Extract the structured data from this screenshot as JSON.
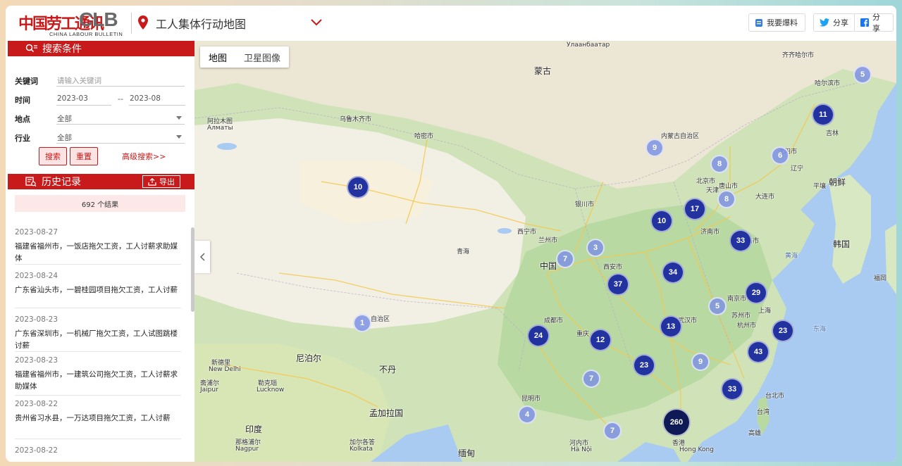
{
  "header": {
    "logo_cn": "中国劳工通讯",
    "logo_en": "CLB",
    "logo_sub": "CHINA LABOUR BULLETIN",
    "title": "工人集体行动地图",
    "report_label": "我要爆料",
    "share_twitter": "分享",
    "share_facebook": "分享"
  },
  "search": {
    "heading": "搜索条件",
    "keyword_label": "关键词",
    "keyword_placeholder": "请输入关键词",
    "time_label": "时间",
    "date_from": "2023-03",
    "date_sep": "--",
    "date_to": "2023-08",
    "location_label": "地点",
    "location_value": "全部",
    "industry_label": "行业",
    "industry_value": "全部",
    "search_button": "搜索",
    "reset_button": "重置",
    "advanced_link": "高级搜索>>"
  },
  "history": {
    "heading": "历史记录",
    "export_label": "导出",
    "results_count": "692 个结果",
    "items": [
      {
        "date": "2023-08-27",
        "text": "福建省福州市，一饭店拖欠工资，工人讨薪求助媒体"
      },
      {
        "date": "2023-08-24",
        "text": "广东省汕头市，一碧桂园项目拖欠工资，工人讨薪"
      },
      {
        "date": "2023-08-23",
        "text": "广东省深圳市，一机械厂拖欠工资，工人试图跳楼讨薪"
      },
      {
        "date": "2023-08-23",
        "text": "福建省福州市，一建筑公司拖欠工资，工人讨薪求助媒体"
      },
      {
        "date": "2023-08-22",
        "text": "贵州省习水县，一万达项目拖欠工资，工人讨薪"
      },
      {
        "date": "2023-08-22",
        "text": ""
      }
    ]
  },
  "map": {
    "map_tab": "地图",
    "satellite_tab": "卫星图像",
    "labels": [
      {
        "text": "Улаанбаатар",
        "cls": ""
      },
      {
        "text": "蒙古",
        "cls": "big"
      },
      {
        "text": "齐齐哈尔市",
        "cls": ""
      },
      {
        "text": "哈尔滨市",
        "cls": ""
      },
      {
        "text": "吉林",
        "cls": ""
      },
      {
        "text": "沈阳市",
        "cls": ""
      },
      {
        "text": "辽宁",
        "cls": ""
      },
      {
        "text": "朝鲜",
        "cls": "big"
      },
      {
        "text": "平壤",
        "cls": ""
      },
      {
        "text": "大连市",
        "cls": ""
      },
      {
        "text": "韩国",
        "cls": "big"
      },
      {
        "text": "黄海",
        "cls": "sea"
      },
      {
        "text": "东海",
        "cls": "sea"
      },
      {
        "text": "北京市",
        "cls": ""
      },
      {
        "text": "天津",
        "cls": ""
      },
      {
        "text": "唐山市",
        "cls": ""
      },
      {
        "text": "济南市",
        "cls": ""
      },
      {
        "text": "青岛市",
        "cls": ""
      },
      {
        "text": "内蒙古自治区",
        "cls": ""
      },
      {
        "text": "银川市",
        "cls": ""
      },
      {
        "text": "兰州市",
        "cls": ""
      },
      {
        "text": "西宁市",
        "cls": ""
      },
      {
        "text": "中国",
        "cls": "big"
      },
      {
        "text": "西安市",
        "cls": ""
      },
      {
        "text": "南京市",
        "cls": ""
      },
      {
        "text": "上海",
        "cls": ""
      },
      {
        "text": "苏州市",
        "cls": ""
      },
      {
        "text": "杭州市",
        "cls": ""
      },
      {
        "text": "武汉市",
        "cls": ""
      },
      {
        "text": "成都市",
        "cls": ""
      },
      {
        "text": "重庆",
        "cls": ""
      },
      {
        "text": "昆明市",
        "cls": ""
      },
      {
        "text": "台北市",
        "cls": ""
      },
      {
        "text": "台湾",
        "cls": ""
      },
      {
        "text": "高雄",
        "cls": ""
      },
      {
        "text": "香港",
        "cls": ""
      },
      {
        "text": "Hong Kong",
        "cls": ""
      },
      {
        "text": "河内市",
        "cls": ""
      },
      {
        "text": "Hà Nội",
        "cls": ""
      },
      {
        "text": "缅甸",
        "cls": "big"
      },
      {
        "text": "不丹",
        "cls": "big"
      },
      {
        "text": "尼泊尔",
        "cls": "big"
      },
      {
        "text": "孟加拉国",
        "cls": "big"
      },
      {
        "text": "印度",
        "cls": "big"
      },
      {
        "text": "新德里",
        "cls": ""
      },
      {
        "text": "New Delhi",
        "cls": ""
      },
      {
        "text": "斋浦尔",
        "cls": ""
      },
      {
        "text": "Jaipur",
        "cls": ""
      },
      {
        "text": "勒克瑙",
        "cls": ""
      },
      {
        "text": "Lucknow",
        "cls": ""
      },
      {
        "text": "加尔各答",
        "cls": ""
      },
      {
        "text": "Kolkata",
        "cls": ""
      },
      {
        "text": "那格浦尔",
        "cls": ""
      },
      {
        "text": "Nagpur",
        "cls": ""
      },
      {
        "text": "阿拉木图",
        "cls": ""
      },
      {
        "text": "Алматы",
        "cls": ""
      },
      {
        "text": "乌鲁木齐市",
        "cls": ""
      },
      {
        "text": "哈密市",
        "cls": ""
      },
      {
        "text": "青海",
        "cls": ""
      },
      {
        "text": "自治区",
        "cls": ""
      },
      {
        "text": "福岡",
        "cls": ""
      }
    ],
    "clusters": [
      {
        "n": "5",
        "style": "light"
      },
      {
        "n": "11",
        "style": "dark"
      },
      {
        "n": "9",
        "style": "light"
      },
      {
        "n": "6",
        "style": "light"
      },
      {
        "n": "8",
        "style": "light"
      },
      {
        "n": "8",
        "style": "light"
      },
      {
        "n": "10",
        "style": "dark"
      },
      {
        "n": "17",
        "style": "dark"
      },
      {
        "n": "10",
        "style": "dark"
      },
      {
        "n": "33",
        "style": "dark"
      },
      {
        "n": "3",
        "style": "light"
      },
      {
        "n": "7",
        "style": "light"
      },
      {
        "n": "34",
        "style": "dark"
      },
      {
        "n": "37",
        "style": "dark"
      },
      {
        "n": "29",
        "style": "dark"
      },
      {
        "n": "5",
        "style": "light"
      },
      {
        "n": "1",
        "style": "light"
      },
      {
        "n": "13",
        "style": "dark"
      },
      {
        "n": "24",
        "style": "dark"
      },
      {
        "n": "12",
        "style": "dark"
      },
      {
        "n": "23",
        "style": "dark"
      },
      {
        "n": "43",
        "style": "dark"
      },
      {
        "n": "23",
        "style": "dark"
      },
      {
        "n": "9",
        "style": "light"
      },
      {
        "n": "7",
        "style": "light"
      },
      {
        "n": "33",
        "style": "dark"
      },
      {
        "n": "4",
        "style": "light"
      },
      {
        "n": "260",
        "style": "huge"
      },
      {
        "n": "7",
        "style": "light"
      }
    ]
  },
  "colors": {
    "brand_red": "#c81a1a",
    "cluster_dark": "#2233a0",
    "cluster_light": "#7e92e4"
  }
}
